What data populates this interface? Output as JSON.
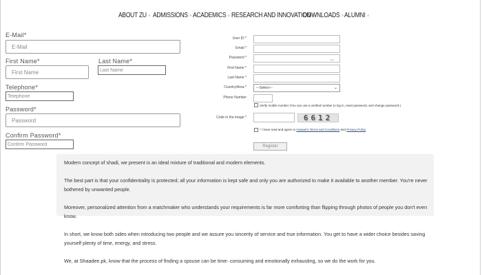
{
  "nav": {
    "items": [
      {
        "label": "ABOUT ZU"
      },
      {
        "label": "ADMISSIONS"
      },
      {
        "label": "ACADEMICS"
      },
      {
        "label": "RESEARCH AND INNOVATION"
      },
      {
        "label": "DOWNLOADS"
      },
      {
        "label": "ALUMNI"
      }
    ]
  },
  "left_form": {
    "email_label": "E-Mail*",
    "email_placeholder": "E-Mail",
    "first_name_label": "First Name*",
    "first_name_placeholder": "First Name",
    "last_name_label": "Last Name*",
    "last_name_placeholder": "Last Name",
    "telephone_label": "Telephone*",
    "telephone_placeholder": "Telephone",
    "password_label": "Password*",
    "password_placeholder": "Password",
    "confirm_label": "Confirm Password*",
    "confirm_placeholder": "Confirm Password"
  },
  "right_form": {
    "user_id_label": "User ID",
    "email_label": "Email",
    "password_label": "Password",
    "first_name_label": "First Name",
    "last_name_label": "Last Name",
    "country_label": "Country/Area",
    "country_value": "---Select---",
    "phone_label": "Phone Number",
    "verify_text": "Verify mobile number (You can use a verified number to log in, reset password, and change password.)",
    "code_label": "Code in the image",
    "captcha_text": "6612",
    "agree_prefix": "I have read and agree to",
    "terms_link": "Huawei's Terms and Conditions",
    "agree_and": "and",
    "privacy_link": "Privacy Policy",
    "register_label": "Register",
    "required_mark": "*"
  },
  "content": {
    "paragraphs": [
      "Modern concept of shadi, we present is an ideal mixture of traditional and modern elements.",
      "The best part is that your confidentiality is protected; all your information is kept safe and only you are authorized to make it available to another member. You're never bothered by unwanted people.",
      "Moreover, personalized attention from a matchmaker who understands your requirements is far more comforting than flipping through photos of people you don't even know.",
      "In short, we know both sides when introducing two people and we assure you sincerity of service and true information. You get to have a wider choice besides saving yourself plenty of time, energy, and stress.",
      "We, at Shaadee.pk, know that the process of finding a spouse can be time- consuming and emotionally exhausting, so we do the work for you."
    ]
  },
  "icons": {
    "chevron": "chevron-down-icon",
    "password_reveal": "eye-icon"
  }
}
